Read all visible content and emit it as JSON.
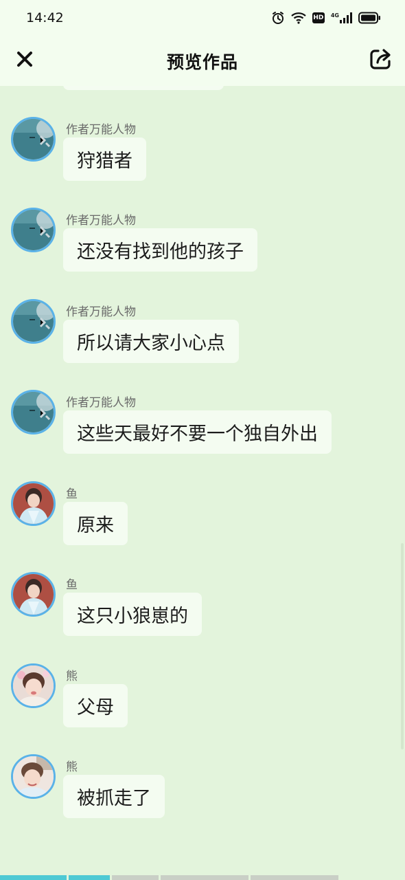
{
  "status_bar": {
    "time": "14:42",
    "network_label": "4G"
  },
  "header": {
    "title": "预览作品"
  },
  "messages": [
    {
      "sender": "作者万能人物",
      "text": "狩猎者",
      "avatar": "teal-scene-avatar"
    },
    {
      "sender": "作者万能人物",
      "text": "还没有找到他的孩子",
      "avatar": "teal-scene-avatar"
    },
    {
      "sender": "作者万能人物",
      "text": "所以请大家小心点",
      "avatar": "teal-scene-avatar"
    },
    {
      "sender": "作者万能人物",
      "text": "这些天最好不要一个独自外出",
      "avatar": "teal-scene-avatar"
    },
    {
      "sender": "鱼",
      "text": "原来",
      "avatar": "portrait-avatar-fish"
    },
    {
      "sender": "鱼",
      "text": "这只小狼崽的",
      "avatar": "portrait-avatar-fish"
    },
    {
      "sender": "熊",
      "text": "父母",
      "avatar": "portrait-avatar-bear"
    },
    {
      "sender": "熊",
      "text": "被抓走了",
      "avatar": "portrait-avatar-bear"
    }
  ],
  "colors": {
    "background": "#e3f4dc",
    "bar_background": "#f3fdef",
    "bubble": "#f4fcf1",
    "avatar_ring": "#5ab2e8",
    "progress_active": "#4ec9d4",
    "progress_inactive": "#c9cfc6"
  },
  "icons": {
    "close": "close-icon",
    "share": "share-icon",
    "alarm": "alarm-icon",
    "wifi": "wifi-icon",
    "hd": "hd-icon",
    "signal": "signal-icon",
    "battery": "battery-icon"
  }
}
